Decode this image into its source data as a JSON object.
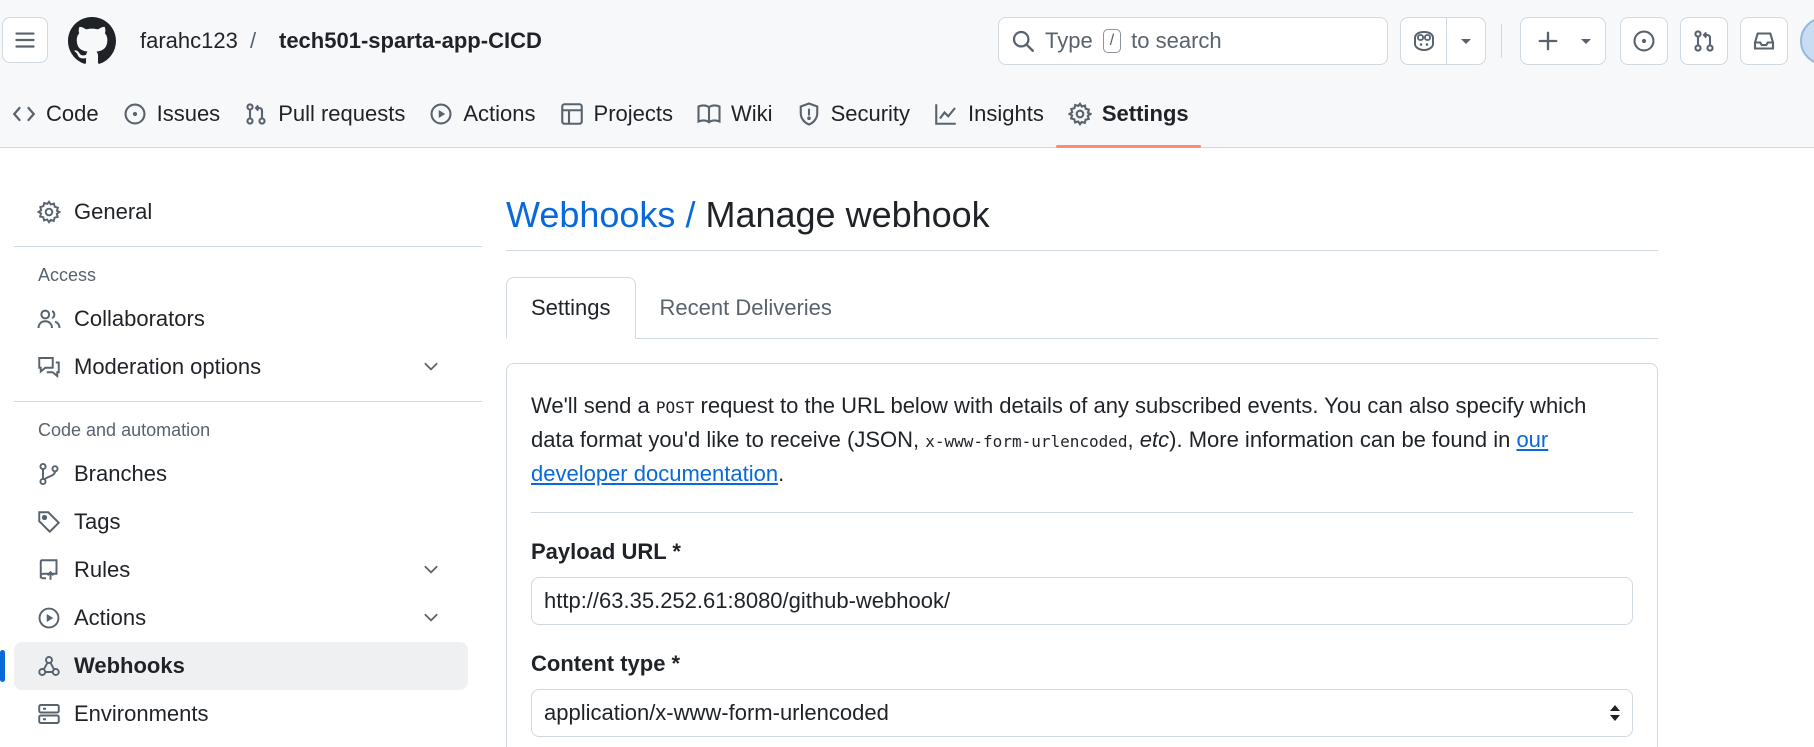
{
  "header": {
    "owner": "farahc123",
    "separator": "/",
    "repo": "tech501-sparta-app-CICD",
    "search": {
      "prefix": "Type",
      "key": "/",
      "suffix": "to search"
    }
  },
  "repo_nav": {
    "items": [
      {
        "label": "Code",
        "icon": "code-icon"
      },
      {
        "label": "Issues",
        "icon": "issue-icon"
      },
      {
        "label": "Pull requests",
        "icon": "pull-request-icon"
      },
      {
        "label": "Actions",
        "icon": "play-icon"
      },
      {
        "label": "Projects",
        "icon": "table-icon"
      },
      {
        "label": "Wiki",
        "icon": "book-icon"
      },
      {
        "label": "Security",
        "icon": "shield-icon"
      },
      {
        "label": "Insights",
        "icon": "graph-icon"
      },
      {
        "label": "Settings",
        "icon": "gear-icon",
        "active": true
      }
    ]
  },
  "sidebar": {
    "general": "General",
    "access_heading": "Access",
    "collaborators": "Collaborators",
    "moderation": "Moderation options",
    "code_heading": "Code and automation",
    "branches": "Branches",
    "tags": "Tags",
    "rules": "Rules",
    "actions": "Actions",
    "webhooks": "Webhooks",
    "environments": "Environments"
  },
  "main": {
    "title_link": "Webhooks /",
    "title": "Manage webhook",
    "tabs": [
      "Settings",
      "Recent Deliveries"
    ],
    "intro": {
      "part1": "We'll send a ",
      "post": "POST",
      "part2": " request to the URL below with details of any subscribed events. You can also specify which data format you'd like to receive (JSON, ",
      "urlencoded": "x-www-form-urlencoded",
      "part3": ", ",
      "etc": "etc",
      "part4": "). More information can be found in ",
      "link": "our developer documentation",
      "part5": "."
    },
    "payload_label": "Payload URL *",
    "payload_value": "http://63.35.252.61:8080/github-webhook/",
    "content_type_label": "Content type *",
    "content_type_value": "application/x-www-form-urlencoded"
  },
  "colors": {
    "link": "#0969da",
    "active_underline": "#fd8c73",
    "border": "#d1d9e0"
  }
}
